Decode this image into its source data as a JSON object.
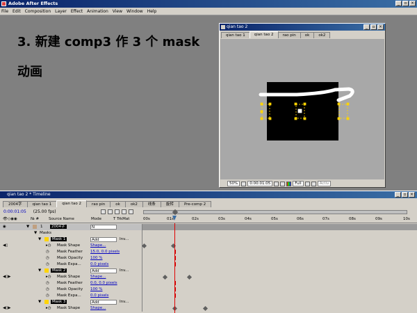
{
  "app": {
    "title": "Adobe After Effects"
  },
  "menu": [
    "File",
    "Edit",
    "Composition",
    "Layer",
    "Effect",
    "Animation",
    "View",
    "Window",
    "Help"
  ],
  "slide": {
    "line1": "3. 新建 comp3 作 3 个 mask",
    "line2": "动画"
  },
  "comp_window": {
    "title": "qian tao 2",
    "tabs": [
      "qian tao 1",
      "qian tao 2",
      "rao pin",
      "ok",
      "ok2"
    ],
    "active_tab": 1,
    "zoom": "50%",
    "time": "0:00:01:05",
    "quality": "Full",
    "camera": "Activ"
  },
  "timeline_window": {
    "title": "qian tao 2 * Timeline",
    "tabs": [
      "2004字",
      "qian tao 1",
      "qian tao 2",
      "rao pin",
      "ok",
      "ok2",
      "线条",
      "旋转",
      "Pre-comp 2"
    ],
    "active_tab": 2,
    "current_time": "0:00:01:05",
    "fps": "(25.00 fps)",
    "columns": {
      "source_name": "Source Name",
      "mode": "Mode",
      "trkmat": "T  TrkMat"
    },
    "ruler_labels": [
      "00s",
      "01s",
      "02s",
      "03s",
      "04s",
      "05s",
      "06s",
      "07s",
      "08s",
      "09s",
      "10s"
    ],
    "layer": {
      "index": "1",
      "name": "2004字",
      "mode": "N"
    },
    "masks_group": "Masks",
    "masks": [
      {
        "name": "Mask 1",
        "mode": "Add",
        "inverted": "Inv...",
        "shape_label": "Mask Shape",
        "shape_value": "Shape...",
        "feather_label": "Mask Feather",
        "feather_value": "15.0, 0.0 pixels",
        "opacity_label": "Mask Opacity",
        "opacity_value": "100 %",
        "expansion_label": "Mask Expa...",
        "expansion_value": "0.0 pixels"
      },
      {
        "name": "Mask 2",
        "mode": "Add",
        "inverted": "Inv...",
        "shape_label": "Mask Shape",
        "shape_value": "Shape...",
        "feather_label": "Mask Feather",
        "feather_value": "0.0, 0.0 pixels",
        "opacity_label": "Mask Opacity",
        "opacity_value": "100 %",
        "expansion_label": "Mask Expa...",
        "expansion_value": "0.0 pixels"
      },
      {
        "name": "Mask 3",
        "mode": "Add",
        "inverted": "Inv...",
        "shape_label": "Mask Shape",
        "shape_value": "Shape..."
      }
    ]
  },
  "colors": {
    "title_bar": "#0a246a",
    "panel": "#d4d0c8",
    "desktop": "#808080",
    "time_indicator": "#e00000"
  }
}
